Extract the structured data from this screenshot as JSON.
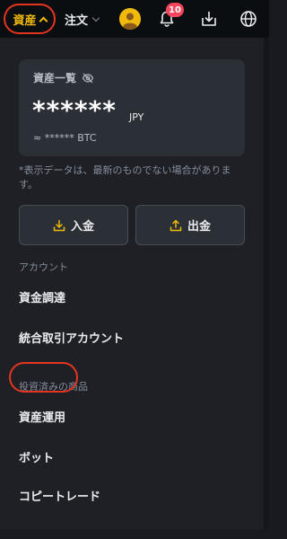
{
  "topbar": {
    "assets_label": "資産",
    "orders_label": "注文",
    "notification_count": "10"
  },
  "balance": {
    "title": "資産一覧",
    "value": "******",
    "currency": "JPY",
    "btc_equiv": "≈ ****** BTC"
  },
  "notice": "*表示データは、最新のものでない場合があります。",
  "actions": {
    "deposit": "入金",
    "withdraw": "出金"
  },
  "sections": {
    "account": {
      "label": "アカウント",
      "items": [
        "資金調達",
        "統合取引アカウント"
      ]
    },
    "invested": {
      "label": "投資済みの商品",
      "items": [
        "資産運用",
        "ボット",
        "コピートレード"
      ]
    }
  },
  "colors": {
    "accent": "#f0b90b",
    "highlight": "#e5341f",
    "badge": "#f6465d"
  }
}
